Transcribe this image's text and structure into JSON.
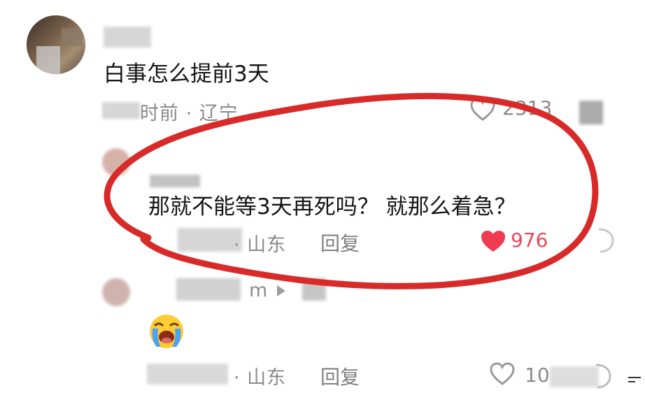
{
  "comment": {
    "text": "白事怎么提前3天",
    "meta": "时前 · 辽宁",
    "likes": "2313"
  },
  "reply1": {
    "text": "那就不能等3天再死吗？ 就那么着急？",
    "location": "· 山东",
    "reply_label": "回复",
    "likes": "976",
    "like_color": "#f03a52"
  },
  "reply2": {
    "author_suffix": "m",
    "emoji": "loudly-crying-face",
    "location": "· 山东",
    "reply_label": "回复",
    "likes": "10"
  },
  "annotation": {
    "color": "#d92a2a",
    "shape": "hand-drawn ellipse"
  }
}
